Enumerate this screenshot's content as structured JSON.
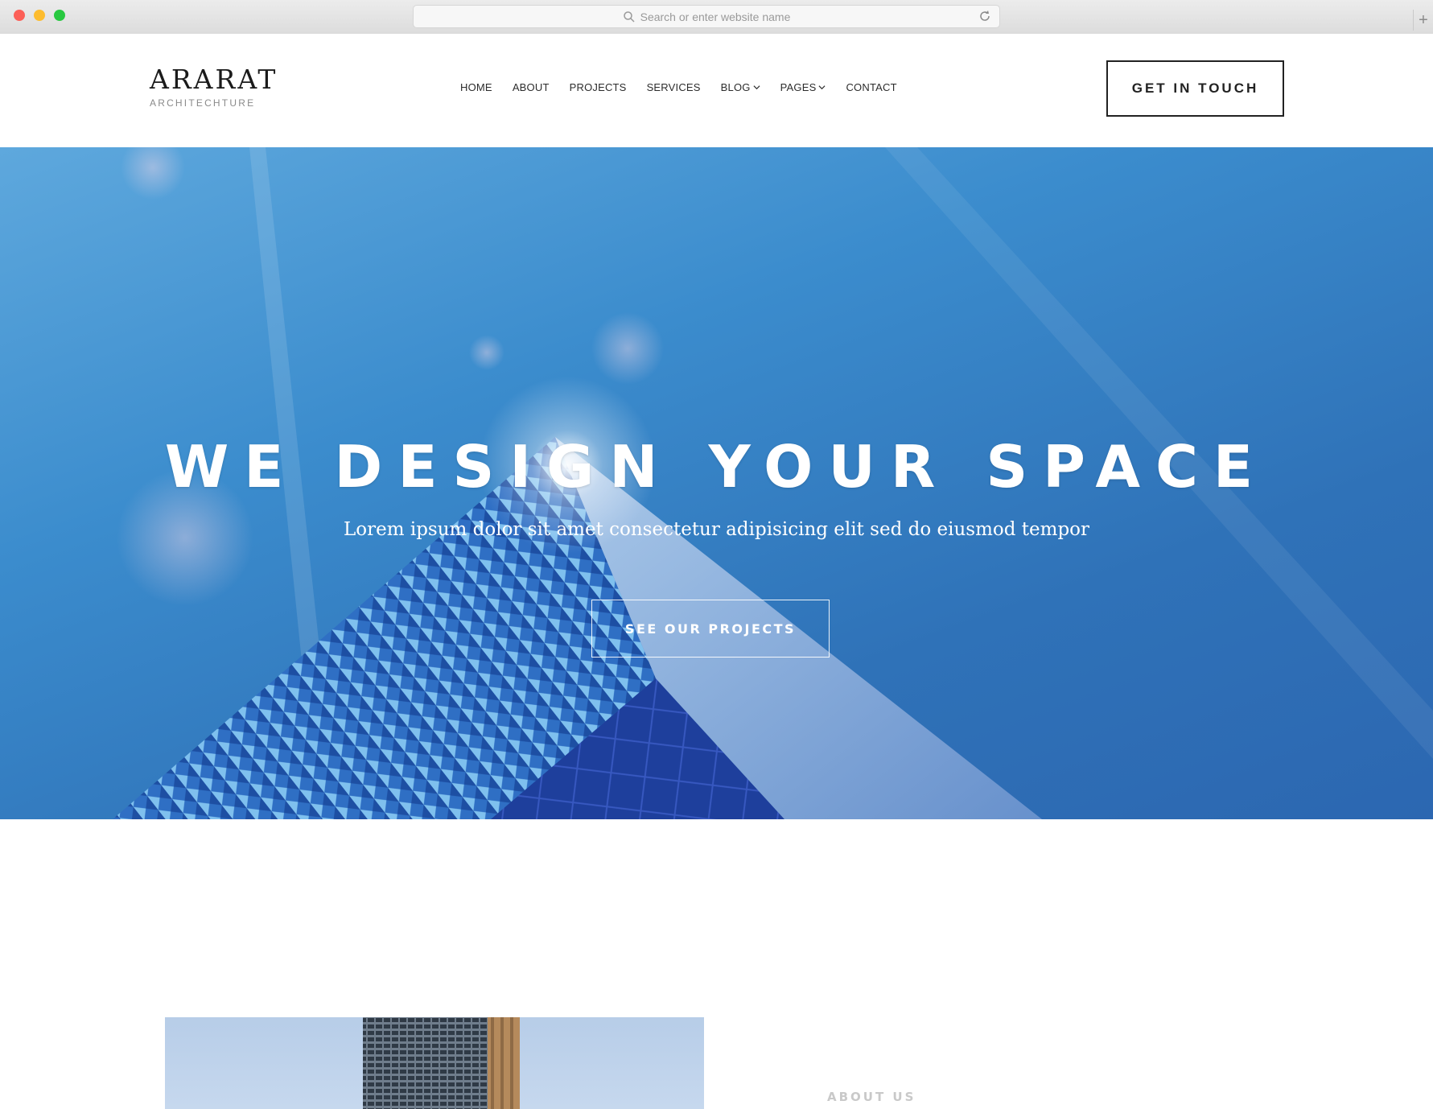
{
  "browser": {
    "address_placeholder": "Search or enter website name",
    "icons": [
      "search-icon",
      "reload-icon",
      "new-tab-icon"
    ]
  },
  "header": {
    "logo_title": "ARARAT",
    "logo_subtitle": "ARCHITECHTURE",
    "nav": [
      {
        "label": "HOME",
        "dropdown": false
      },
      {
        "label": "ABOUT",
        "dropdown": false
      },
      {
        "label": "PROJECTS",
        "dropdown": false
      },
      {
        "label": "SERVICES",
        "dropdown": false
      },
      {
        "label": "BLOG",
        "dropdown": true
      },
      {
        "label": "PAGES",
        "dropdown": true
      },
      {
        "label": "CONTACT",
        "dropdown": false
      }
    ],
    "cta_label": "GET IN TOUCH"
  },
  "hero": {
    "title": "WE DESIGN YOUR SPACE",
    "subtitle": "Lorem ipsum dolor sit amet consectetur adipisicing elit sed do eiusmod tempor",
    "button_label": "SEE OUR PROJECTS"
  },
  "about": {
    "label": "ABOUT US"
  },
  "colors": {
    "hero_blue": "#3b8ccd",
    "text_dark": "#222222",
    "white": "#ffffff",
    "muted_label": "#c9c9c9"
  }
}
